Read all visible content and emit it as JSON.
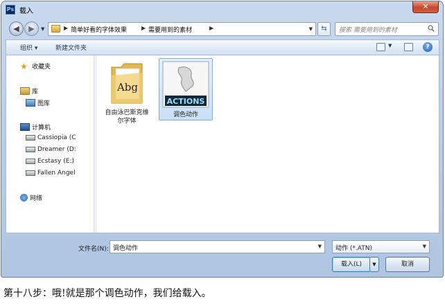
{
  "window": {
    "app_icon_text": "Ps",
    "title": "载入",
    "close_glyph": "✕"
  },
  "address": {
    "crumbs": [
      "简单好看的字体效果",
      "需要用到的素材"
    ],
    "search_placeholder": "搜索 需要用到的素材"
  },
  "toolbar": {
    "organize_label": "组织 ▾",
    "new_folder_label": "新建文件夹",
    "help_label": "?"
  },
  "sidebar": {
    "favorites_label": "收藏夹",
    "library_label": "库",
    "pictures_label": "图库",
    "computer_label": "计算机",
    "drives": [
      "Cassiopia (C",
      "Dreamer (D:",
      "Ecstasy (E:)",
      "Fallen Angel"
    ],
    "network_label": "网络"
  },
  "files": [
    {
      "name_lines": [
        "自由泳巴斯克维",
        "尔字体"
      ],
      "icon_text": "Abg",
      "selected": false
    },
    {
      "name_lines": [
        "调色动作"
      ],
      "icon_text": "ACTIONS",
      "selected": true
    }
  ],
  "footer": {
    "filename_label": "文件名(N):",
    "filename_value": "调色动作",
    "filetype_value": "动作 (*.ATN)",
    "load_label": "载入(L)",
    "cancel_label": "取消"
  },
  "caption": "第十八步：哦!就是那个调色动作，我们给载入。",
  "colors": {
    "frame": "#b7cbe5",
    "selection": "#c9e0f8",
    "close": "#c7452c"
  }
}
